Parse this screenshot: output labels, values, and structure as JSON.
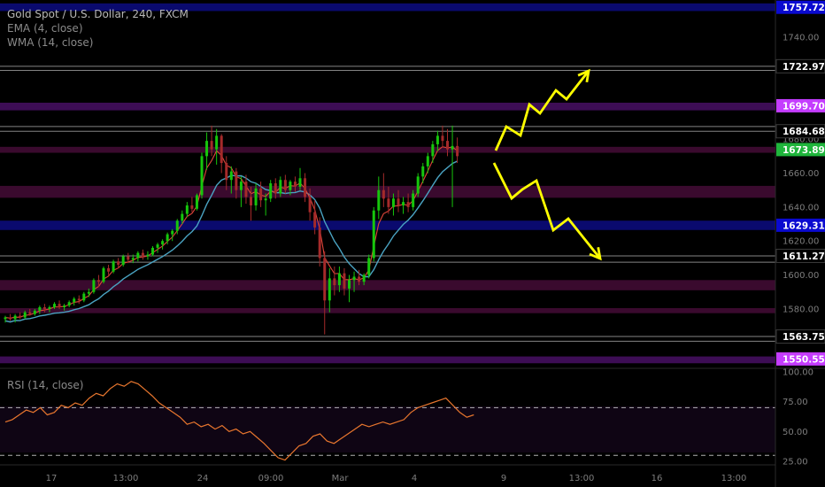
{
  "header": {
    "symbol": "Gold Spot / U.S. Dollar, 240, FXCM",
    "ema": "EMA (4, close)",
    "wma": "WMA (14, close)"
  },
  "rsi_panel": {
    "label": "RSI (14, close)"
  },
  "colors": {
    "bull": "#16c60c",
    "bear": "#a52a2a",
    "ema": "#e0463a",
    "wma": "#4aa3c2",
    "rsi": "#e8762e",
    "arrow": "#ffff00",
    "purple": "#c43cff",
    "green_tag": "#1fb53c"
  },
  "chart_data": [
    {
      "type": "candlestick",
      "title": "Gold Spot / U.S. Dollar, 240, FXCM",
      "ylim": [
        1545,
        1762
      ],
      "y_ticks": [
        1580,
        1600,
        1620,
        1640,
        1660,
        1680,
        1740
      ],
      "x_ticks": [
        "17",
        "13:00",
        "24",
        "09:00",
        "Mar",
        "4",
        "9",
        "13:00",
        "16",
        "13:00"
      ],
      "price_tags": [
        {
          "label": "1757.72",
          "value": 1757.72,
          "color": "#0a0ad0"
        },
        {
          "label": "1722.97",
          "value": 1722.97,
          "color": "#000000"
        },
        {
          "label": "1699.70",
          "value": 1699.7,
          "color": "#c43cff"
        },
        {
          "label": "1684.68",
          "value": 1684.68,
          "color": "#000000"
        },
        {
          "label": "1673.89",
          "value": 1673.89,
          "color": "#1fb53c"
        },
        {
          "label": "1629.31",
          "value": 1629.31,
          "color": "#0a0ad0"
        },
        {
          "label": "1611.27",
          "value": 1611.27,
          "color": "#000000"
        },
        {
          "label": "1563.75",
          "value": 1563.75,
          "color": "#000000"
        },
        {
          "label": "1550.55",
          "value": 1550.55,
          "color": "#c43cff"
        }
      ],
      "zones": [
        {
          "from": 1755.5,
          "to": 1760.0,
          "color": "#0a0a6e"
        },
        {
          "from": 1697.0,
          "to": 1701.5,
          "color": "#3d0d55"
        },
        {
          "from": 1672.0,
          "to": 1675.5,
          "color": "#3a0a2e"
        },
        {
          "from": 1645.5,
          "to": 1652.5,
          "color": "#3a0a2e"
        },
        {
          "from": 1626.5,
          "to": 1632.0,
          "color": "#0a0a6e"
        },
        {
          "from": 1591.0,
          "to": 1597.0,
          "color": "#3a0a2e"
        },
        {
          "from": 1577.5,
          "to": 1580.5,
          "color": "#3a0a2e"
        },
        {
          "from": 1548.0,
          "to": 1552.0,
          "color": "#3d0d55"
        }
      ],
      "levels": [
        1722.97,
        1720.5,
        1687.5,
        1684.68,
        1611.27,
        1607.5,
        1563.75,
        1561.0
      ],
      "candles": [
        [
          1574,
          1576,
          1572,
          1575
        ],
        [
          1575,
          1577,
          1573,
          1574
        ],
        [
          1574,
          1577,
          1572,
          1576
        ],
        [
          1576,
          1578,
          1574,
          1575
        ],
        [
          1575,
          1579,
          1574,
          1578
        ],
        [
          1578,
          1580,
          1576,
          1577
        ],
        [
          1577,
          1580,
          1576,
          1579
        ],
        [
          1579,
          1582,
          1577,
          1581
        ],
        [
          1581,
          1583,
          1578,
          1580
        ],
        [
          1580,
          1582,
          1578,
          1581
        ],
        [
          1581,
          1584,
          1580,
          1583
        ],
        [
          1583,
          1585,
          1580,
          1581
        ],
        [
          1581,
          1583,
          1579,
          1582
        ],
        [
          1582,
          1585,
          1581,
          1584
        ],
        [
          1584,
          1587,
          1582,
          1586
        ],
        [
          1586,
          1588,
          1583,
          1585
        ],
        [
          1585,
          1590,
          1584,
          1589
        ],
        [
          1589,
          1592,
          1587,
          1590
        ],
        [
          1590,
          1598,
          1589,
          1597
        ],
        [
          1597,
          1600,
          1593,
          1596
        ],
        [
          1596,
          1605,
          1595,
          1604
        ],
        [
          1604,
          1606,
          1600,
          1602
        ],
        [
          1602,
          1609,
          1601,
          1608
        ],
        [
          1608,
          1610,
          1604,
          1606
        ],
        [
          1606,
          1612,
          1605,
          1611
        ],
        [
          1611,
          1613,
          1607,
          1609
        ],
        [
          1609,
          1612,
          1607,
          1610
        ],
        [
          1610,
          1614,
          1608,
          1613
        ],
        [
          1613,
          1615,
          1609,
          1611
        ],
        [
          1611,
          1614,
          1609,
          1612
        ],
        [
          1612,
          1617,
          1611,
          1616
        ],
        [
          1616,
          1619,
          1613,
          1618
        ],
        [
          1618,
          1621,
          1615,
          1620
        ],
        [
          1620,
          1625,
          1618,
          1624
        ],
        [
          1624,
          1627,
          1620,
          1626
        ],
        [
          1626,
          1633,
          1624,
          1632
        ],
        [
          1632,
          1638,
          1630,
          1636
        ],
        [
          1636,
          1643,
          1634,
          1641
        ],
        [
          1641,
          1646,
          1637,
          1639
        ],
        [
          1639,
          1648,
          1638,
          1647
        ],
        [
          1647,
          1672,
          1645,
          1670
        ],
        [
          1670,
          1684,
          1662,
          1679
        ],
        [
          1679,
          1688,
          1670,
          1674
        ],
        [
          1674,
          1686,
          1665,
          1682
        ],
        [
          1682,
          1683,
          1660,
          1666
        ],
        [
          1666,
          1670,
          1650,
          1656
        ],
        [
          1656,
          1664,
          1648,
          1661
        ],
        [
          1661,
          1663,
          1645,
          1650
        ],
        [
          1650,
          1658,
          1640,
          1655
        ],
        [
          1655,
          1659,
          1642,
          1646
        ],
        [
          1646,
          1652,
          1632,
          1641
        ],
        [
          1641,
          1654,
          1638,
          1651
        ],
        [
          1651,
          1655,
          1640,
          1644
        ],
        [
          1644,
          1648,
          1635,
          1645
        ],
        [
          1645,
          1656,
          1643,
          1654
        ],
        [
          1654,
          1657,
          1645,
          1648
        ],
        [
          1648,
          1658,
          1646,
          1656
        ],
        [
          1656,
          1659,
          1648,
          1650
        ],
        [
          1650,
          1656,
          1647,
          1655
        ],
        [
          1655,
          1658,
          1649,
          1652
        ],
        [
          1652,
          1663,
          1650,
          1657
        ],
        [
          1657,
          1660,
          1643,
          1646
        ],
        [
          1646,
          1651,
          1632,
          1637
        ],
        [
          1637,
          1644,
          1624,
          1628
        ],
        [
          1628,
          1634,
          1605,
          1610
        ],
        [
          1610,
          1614,
          1565,
          1585
        ],
        [
          1585,
          1604,
          1578,
          1598
        ],
        [
          1598,
          1605,
          1588,
          1594
        ],
        [
          1594,
          1605,
          1590,
          1601
        ],
        [
          1601,
          1604,
          1588,
          1592
        ],
        [
          1592,
          1600,
          1584,
          1597
        ],
        [
          1597,
          1602,
          1590,
          1599
        ],
        [
          1599,
          1603,
          1594,
          1596
        ],
        [
          1596,
          1601,
          1594,
          1600
        ],
        [
          1600,
          1612,
          1598,
          1610
        ],
        [
          1610,
          1640,
          1608,
          1638
        ],
        [
          1638,
          1658,
          1633,
          1650
        ],
        [
          1650,
          1660,
          1640,
          1645
        ],
        [
          1645,
          1652,
          1636,
          1640
        ],
        [
          1640,
          1648,
          1635,
          1645
        ],
        [
          1645,
          1650,
          1637,
          1641
        ],
        [
          1641,
          1646,
          1636,
          1643
        ],
        [
          1643,
          1648,
          1637,
          1640
        ],
        [
          1640,
          1650,
          1638,
          1648
        ],
        [
          1648,
          1660,
          1646,
          1658
        ],
        [
          1658,
          1666,
          1654,
          1664
        ],
        [
          1664,
          1672,
          1660,
          1670
        ],
        [
          1670,
          1679,
          1666,
          1677
        ],
        [
          1677,
          1685,
          1673,
          1682
        ],
        [
          1682,
          1688,
          1675,
          1679
        ],
        [
          1679,
          1686,
          1670,
          1674
        ],
        [
          1674,
          1688,
          1640,
          1676
        ],
        [
          1676,
          1681,
          1666,
          1670
        ]
      ],
      "forecast_arrows": [
        [
          [
            560,
            170
          ],
          [
            572,
            143
          ],
          [
            588,
            153
          ],
          [
            598,
            118
          ],
          [
            610,
            128
          ],
          [
            628,
            102
          ],
          [
            640,
            112
          ],
          [
            665,
            80
          ]
        ],
        [
          [
            558,
            184
          ],
          [
            578,
            224
          ],
          [
            590,
            214
          ],
          [
            606,
            204
          ],
          [
            625,
            260
          ],
          [
            642,
            247
          ],
          [
            678,
            292
          ]
        ]
      ]
    },
    {
      "type": "line",
      "title": "RSI (14, close)",
      "ylim": [
        22,
        103
      ],
      "y_ticks": [
        25,
        50,
        75,
        100
      ],
      "tick_labels": [
        "25.00",
        "50.00",
        "75.00",
        "100.00"
      ],
      "dashed_levels": [
        70,
        30
      ],
      "values": [
        58,
        60,
        64,
        68,
        66,
        70,
        64,
        66,
        72,
        70,
        74,
        72,
        78,
        82,
        80,
        86,
        90,
        88,
        92,
        90,
        85,
        80,
        74,
        70,
        66,
        62,
        56,
        58,
        54,
        56,
        52,
        55,
        50,
        52,
        48,
        50,
        45,
        40,
        34,
        28,
        26,
        32,
        38,
        40,
        46,
        48,
        42,
        40,
        44,
        48,
        52,
        56,
        54,
        56,
        58,
        56,
        58,
        60,
        66,
        70,
        72,
        74,
        76,
        78,
        72,
        66,
        62,
        64
      ]
    }
  ]
}
